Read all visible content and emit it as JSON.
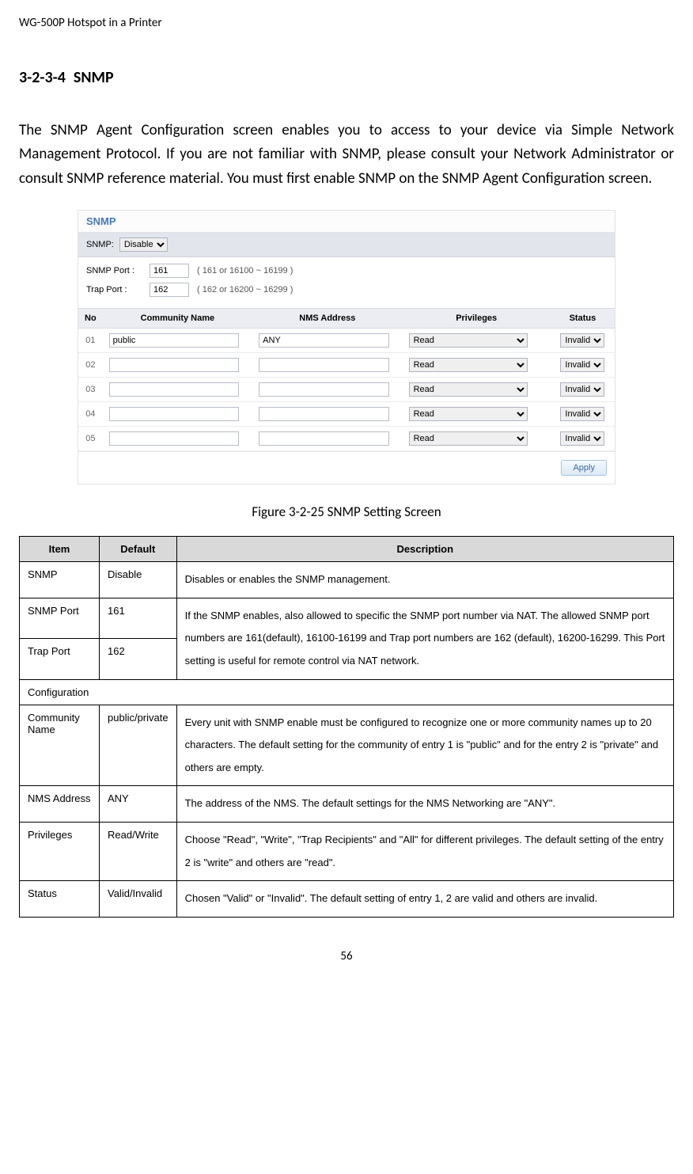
{
  "header": "WG-500P Hotspot in a Printer",
  "section_number": "3-2-3-4",
  "section_title": "SNMP",
  "intro": "The SNMP Agent Configuration screen enables you to access to your device via Simple Network Management Protocol. If you are not familiar with SNMP, please consult your Network Administrator or consult SNMP reference material. You must first enable SNMP on the SNMP Agent Configuration screen.",
  "screenshot": {
    "title": "SNMP",
    "snmp_label": "SNMP:",
    "snmp_value": "Disable",
    "snmp_port_label": "SNMP Port :",
    "snmp_port_value": "161",
    "snmp_port_hint": "( 161 or 16100 ~ 16199 )",
    "trap_port_label": "Trap Port :",
    "trap_port_value": "162",
    "trap_port_hint": "( 162 or 16200 ~ 16299 )",
    "cols": {
      "no": "No",
      "community": "Community Name",
      "nms": "NMS Address",
      "priv": "Privileges",
      "status": "Status"
    },
    "rows": [
      {
        "no": "01",
        "community": "public",
        "nms": "ANY",
        "priv": "Read",
        "status": "Invalid"
      },
      {
        "no": "02",
        "community": "",
        "nms": "",
        "priv": "Read",
        "status": "Invalid"
      },
      {
        "no": "03",
        "community": "",
        "nms": "",
        "priv": "Read",
        "status": "Invalid"
      },
      {
        "no": "04",
        "community": "",
        "nms": "",
        "priv": "Read",
        "status": "Invalid"
      },
      {
        "no": "05",
        "community": "",
        "nms": "",
        "priv": "Read",
        "status": "Invalid"
      }
    ],
    "apply": "Apply"
  },
  "figure_caption": "Figure 3-2-25 SNMP Setting Screen",
  "table": {
    "headers": {
      "item": "Item",
      "default": "Default",
      "description": "Description"
    },
    "rows": {
      "snmp": {
        "item": "SNMP",
        "default": "Disable",
        "desc": "Disables or enables the SNMP management."
      },
      "snmp_port": {
        "item": "SNMP Port",
        "default": "161"
      },
      "trap_port": {
        "item": "Trap Port",
        "default": "162",
        "desc": "If the SNMP enables, also allowed to specific the SNMP port number via NAT. The allowed SNMP port numbers are 161(default), 16100-16199 and Trap port numbers are 162 (default), 16200-16299. This Port setting is useful for remote control via NAT network."
      },
      "configuration": "Configuration",
      "community": {
        "item": "Community Name",
        "default": "public/private",
        "desc": "Every unit with SNMP enable must be configured to recognize one or more community names up to 20 characters. The default setting for the community of entry 1 is \"public\" and for the entry 2 is \"private\" and others are empty."
      },
      "nms": {
        "item": "NMS Address",
        "default": "ANY",
        "desc": "The address of the NMS. The default settings for the NMS Networking are \"ANY\"."
      },
      "privileges": {
        "item": "Privileges",
        "default": "Read/Write",
        "desc": "Choose \"Read\", \"Write\", \"Trap Recipients\" and \"All\" for different privileges. The default setting of the entry 2 is \"write\" and others are \"read\"."
      },
      "status": {
        "item": "Status",
        "default": "Valid/Invalid",
        "desc": "Chosen \"Valid\" or \"Invalid\". The default setting of entry 1, 2 are valid and others are invalid."
      }
    }
  },
  "page_number": "56"
}
